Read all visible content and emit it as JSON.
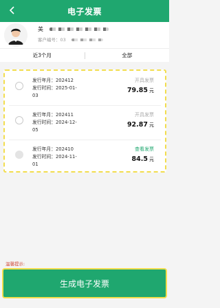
{
  "header": {
    "title": "电子发票"
  },
  "user": {
    "name_prefix": "美",
    "account_label": "客户编号：03"
  },
  "filters": [
    {
      "label": "近3个月"
    },
    {
      "label": "全部"
    }
  ],
  "invoices": [
    {
      "month_label": "发行年月：",
      "month": "202412",
      "time_label": "发行时间：",
      "time_line1": "2025-01-",
      "time_line2": "03",
      "action": "开具发票",
      "amount": "79.85",
      "unit": "元"
    },
    {
      "month_label": "发行年月：",
      "month": "202411",
      "time_label": "发行时间：",
      "time_line1": "2024-12-",
      "time_line2": "05",
      "action": "开具发票",
      "amount": "92.87",
      "unit": "元"
    },
    {
      "month_label": "发行年月：",
      "month": "202410",
      "time_label": "发行时间：",
      "time_line1": "2024-11-",
      "time_line2": "01",
      "action": "查看发票",
      "amount": "84.5",
      "unit": "元"
    }
  ],
  "tip": {
    "label": "温馨提示:"
  },
  "footer": {
    "button_label": "生成电子发票"
  },
  "colors": {
    "brand": "#1fa76f",
    "highlight": "#f2dd4d",
    "tip": "#d14a3a"
  }
}
